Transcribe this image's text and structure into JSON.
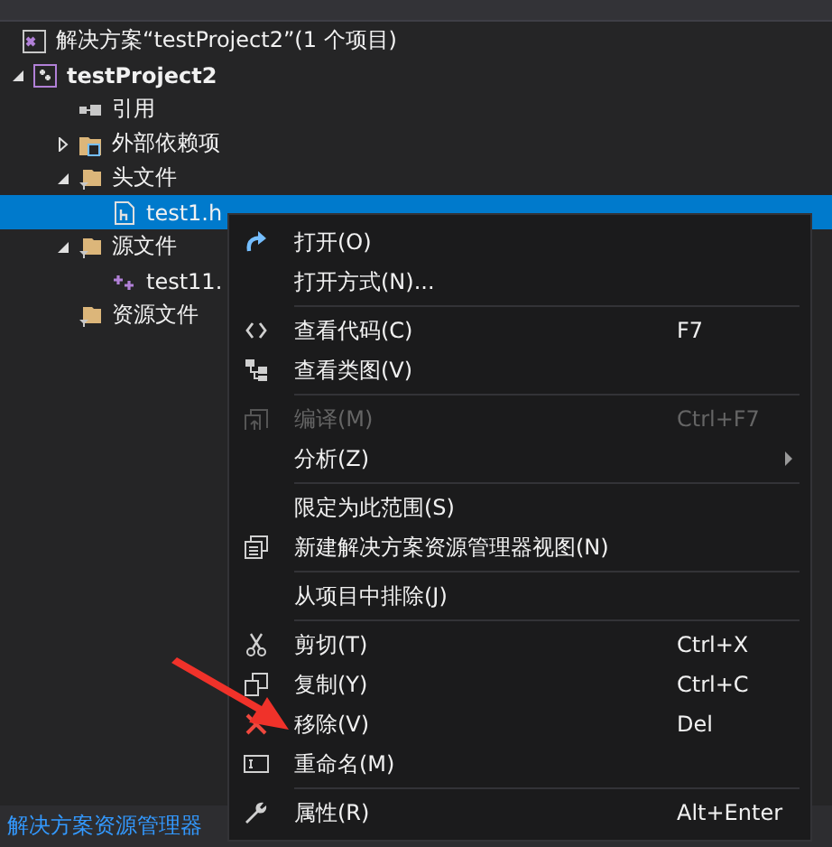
{
  "solution": {
    "label": "解决方案“testProject2”(1 个项目)"
  },
  "project": {
    "label": "testProject2",
    "expanded": true,
    "children": [
      {
        "kind": "references",
        "label": "引用"
      },
      {
        "kind": "external",
        "label": "外部依赖项",
        "expanded": false
      },
      {
        "kind": "filter",
        "label": "头文件",
        "expanded": true,
        "children": [
          {
            "kind": "header",
            "label": "test1.h",
            "selected": true
          }
        ]
      },
      {
        "kind": "filter",
        "label": "源文件",
        "expanded": true,
        "children": [
          {
            "kind": "cpp",
            "label": "test11.",
            "selected": false
          }
        ]
      },
      {
        "kind": "filter",
        "label": "资源文件"
      }
    ]
  },
  "context_menu": {
    "groups": [
      [
        {
          "kind": "open",
          "label": "打开(O)",
          "disabled": false
        },
        {
          "label": "打开方式(N)...",
          "disabled": false
        }
      ],
      [
        {
          "kind": "code",
          "label": "查看代码(C)",
          "shortcut": "F7",
          "disabled": false
        },
        {
          "kind": "diagram",
          "label": "查看类图(V)",
          "disabled": false
        }
      ],
      [
        {
          "kind": "compile",
          "label": "编译(M)",
          "shortcut": "Ctrl+F7",
          "disabled": true
        },
        {
          "label": "分析(Z)",
          "submenu": true,
          "disabled": false
        }
      ],
      [
        {
          "label": "限定为此范围(S)",
          "disabled": false
        },
        {
          "kind": "newview",
          "label": "新建解决方案资源管理器视图(N)",
          "disabled": false
        }
      ],
      [
        {
          "label": "从项目中排除(J)",
          "disabled": false
        }
      ],
      [
        {
          "kind": "cut",
          "label": "剪切(T)",
          "shortcut": "Ctrl+X",
          "disabled": false
        },
        {
          "kind": "copy",
          "label": "复制(Y)",
          "shortcut": "Ctrl+C",
          "disabled": false
        },
        {
          "kind": "remove",
          "label": "移除(V)",
          "shortcut": "Del",
          "disabled": false
        },
        {
          "kind": "rename",
          "label": "重命名(M)",
          "disabled": false
        }
      ],
      [
        {
          "kind": "wrench",
          "label": "属性(R)",
          "shortcut": "Alt+Enter",
          "disabled": false
        }
      ]
    ]
  },
  "bottom_tabs": [
    {
      "label": "解决方案资源管理器",
      "selected": true
    }
  ]
}
